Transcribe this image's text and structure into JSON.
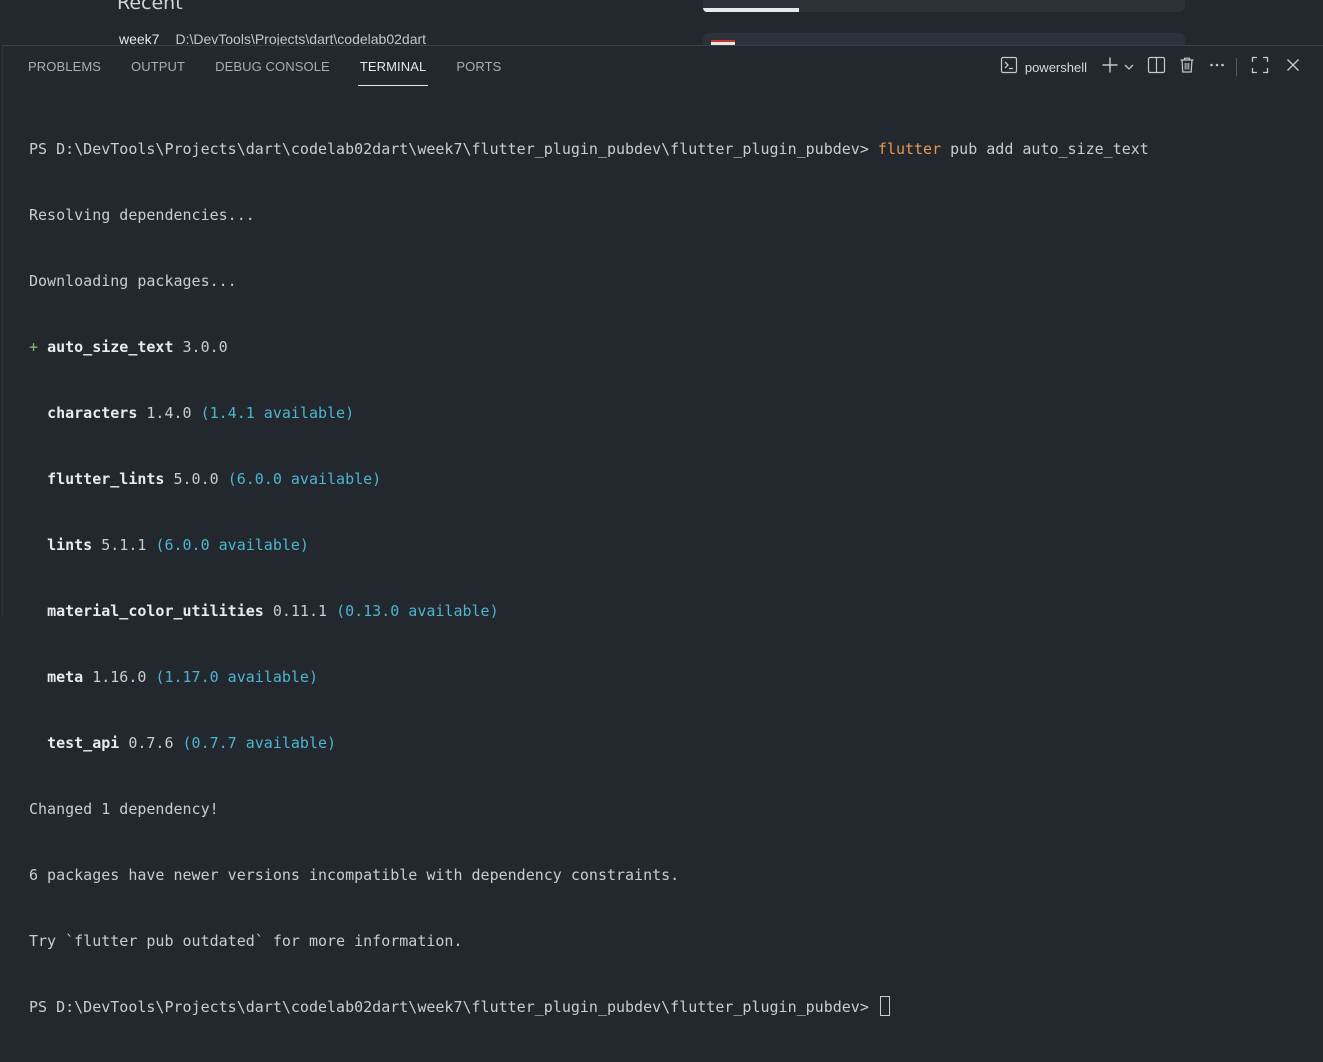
{
  "welcome": {
    "recent_heading": "Recent",
    "recent_items": [
      {
        "name": "week7",
        "path": "D:\\DevTools\\Projects\\dart\\codelab02dart"
      }
    ]
  },
  "panel": {
    "tabs": [
      {
        "label": "PROBLEMS",
        "active": false
      },
      {
        "label": "OUTPUT",
        "active": false
      },
      {
        "label": "DEBUG CONSOLE",
        "active": false
      },
      {
        "label": "TERMINAL",
        "active": true
      },
      {
        "label": "PORTS",
        "active": false
      }
    ],
    "shell_label": "powershell",
    "icons": {
      "shell": "terminal-icon",
      "new": "plus-icon",
      "dropdown": "chevron-down-icon",
      "split": "split-icon",
      "trash": "trash-icon",
      "more": "ellipsis-icon",
      "maximize": "maximize-icon",
      "close": "close-icon"
    }
  },
  "terminal": {
    "prompt": "PS D:\\DevTools\\Projects\\dart\\codelab02dart\\week7\\flutter_plugin_pubdev\\flutter_plugin_pubdev> ",
    "command_head": "flutter",
    "command_rest": " pub add auto_size_text",
    "resolving": "Resolving dependencies...",
    "downloading": "Downloading packages...",
    "added": {
      "marker": "+ ",
      "name": "auto_size_text",
      "version": " 3.0.0"
    },
    "packages": [
      {
        "name": "characters",
        "version": " 1.4.0 ",
        "available": "(1.4.1 available)"
      },
      {
        "name": "flutter_lints",
        "version": " 5.0.0 ",
        "available": "(6.0.0 available)"
      },
      {
        "name": "lints",
        "version": " 5.1.1 ",
        "available": "(6.0.0 available)"
      },
      {
        "name": "material_color_utilities",
        "version": " 0.11.1 ",
        "available": "(0.13.0 available)"
      },
      {
        "name": "meta",
        "version": " 1.16.0 ",
        "available": "(1.17.0 available)"
      },
      {
        "name": "test_api",
        "version": " 0.7.6 ",
        "available": "(0.7.7 available)"
      }
    ],
    "changed": "Changed 1 dependency!",
    "newer": "6 packages have newer versions incompatible with dependency constraints.",
    "try_hint": "Try `flutter pub outdated` for more information.",
    "colors": {
      "command": "#e5994d",
      "available": "#4cb6cf",
      "added_marker": "#7fc46e"
    }
  }
}
